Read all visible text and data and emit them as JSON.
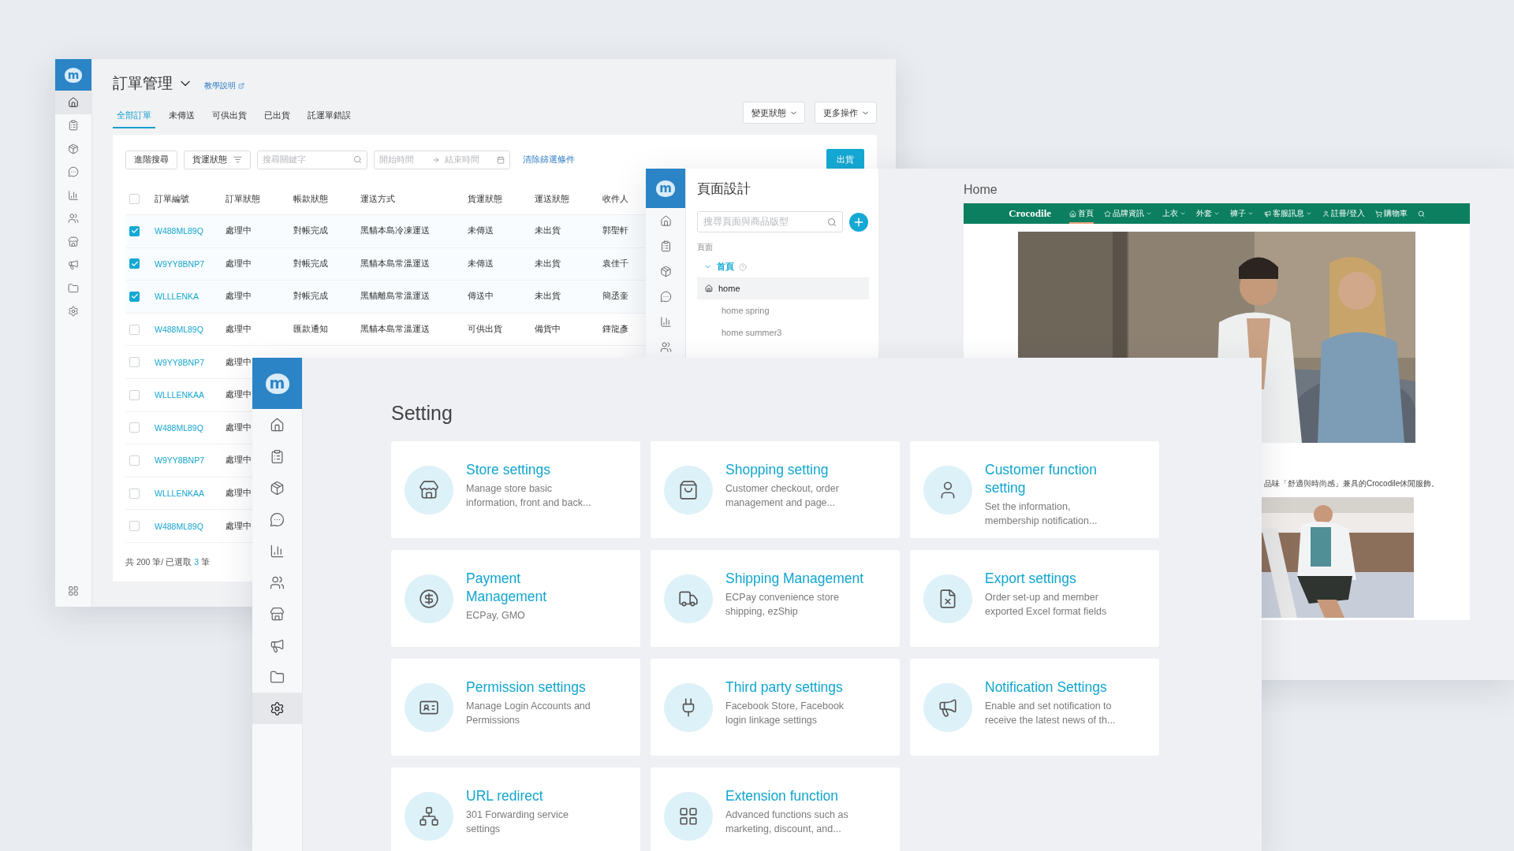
{
  "orders_window": {
    "sidebar": {
      "logo": "m",
      "items": [
        {
          "selected": true
        },
        {
          "selected": false
        },
        {
          "selected": false
        },
        {
          "selected": false
        },
        {
          "selected": false
        },
        {
          "selected": false
        },
        {
          "selected": false
        },
        {
          "selected": false
        },
        {
          "selected": false
        },
        {
          "selected": false
        }
      ]
    },
    "title": "訂單管理",
    "help_link": "教學說明",
    "tabs": [
      {
        "label": "全部訂單",
        "selected": true
      },
      {
        "label": "未傳送",
        "selected": false
      },
      {
        "label": "可供出貨",
        "selected": false
      },
      {
        "label": "已出貨",
        "selected": false
      },
      {
        "label": "託運單錯誤",
        "selected": false
      }
    ],
    "actions": [
      "變更狀態",
      "更多操作"
    ],
    "filters": {
      "advanced_search": "進階搜尋",
      "status_filter": "貨運狀態",
      "search": {
        "placeholder": "搜尋關鍵字"
      },
      "start_date": {
        "placeholder": "開始時間"
      },
      "end_date": {
        "placeholder": "結束時間"
      },
      "clear": "清除篩選條件"
    },
    "ship_button": "出貨",
    "table": {
      "select_all_checked": false,
      "columns": [
        "訂單編號",
        "訂單狀態",
        "帳款狀態",
        "運送方式",
        "貨運狀態",
        "運送狀態",
        "收件人"
      ],
      "rows": [
        {
          "checked": true,
          "cells": [
            "W488ML89Q",
            "處理中",
            "對帳完成",
            "黑貓本島冷凍運送",
            "未傳送",
            "未出貨",
            "郭聖軒"
          ]
        },
        {
          "checked": true,
          "cells": [
            "W9YY8BNP7",
            "處理中",
            "對帳完成",
            "黑貓本島常溫運送",
            "未傳送",
            "未出貨",
            "袁佳千"
          ]
        },
        {
          "checked": true,
          "cells": [
            "WLLLENKA",
            "處理中",
            "對帳完成",
            "黑貓離島常溫運送",
            "傳送中",
            "未出貨",
            "簡丞奎"
          ]
        },
        {
          "checked": false,
          "cells": [
            "W488ML89Q",
            "處理中",
            "匯款通知",
            "黑貓本島常溫運送",
            "可供出貨",
            "備貨中",
            "鍾龍彥"
          ]
        },
        {
          "checked": false,
          "cells": [
            "W9YY8BNP7",
            "處理中"
          ]
        },
        {
          "checked": false,
          "cells": [
            "WLLLENKAA",
            "處理中"
          ]
        },
        {
          "checked": false,
          "cells": [
            "W488ML89Q",
            "處理中"
          ]
        },
        {
          "checked": false,
          "cells": [
            "W9YY8BNP7",
            "處理中"
          ]
        },
        {
          "checked": false,
          "cells": [
            "WLLLENKAA",
            "處理中"
          ]
        },
        {
          "checked": false,
          "cells": [
            "W488ML89Q",
            "處理中"
          ]
        }
      ]
    },
    "footer": {
      "total": "共 200 筆/ 已選取",
      "selected_count": "3",
      "unit": "筆"
    }
  },
  "page_design_window": {
    "logo": "m",
    "title": "頁面設計",
    "search": {
      "placeholder": "搜尋頁面與商品版型"
    },
    "section_label": "頁面",
    "tree": [
      {
        "label": "首頁",
        "expanded": true,
        "children": [
          {
            "label": "home",
            "selected": true
          },
          {
            "label": "home spring",
            "selected": false
          },
          {
            "label": "home summer3",
            "selected": false
          }
        ]
      }
    ],
    "preview": {
      "title": "Home",
      "site_logo": "Crocodile",
      "nav": [
        {
          "label": "首頁",
          "selected": true,
          "dropdown": false
        },
        {
          "label": "品牌資訊",
          "selected": false,
          "dropdown": true
        },
        {
          "label": "上衣",
          "selected": false,
          "dropdown": true
        },
        {
          "label": "外套",
          "selected": false,
          "dropdown": true
        },
        {
          "label": "褲子",
          "selected": false,
          "dropdown": true
        },
        {
          "label": "客服訊息",
          "selected": false,
          "dropdown": true
        },
        {
          "label": "註冊/登入",
          "selected": false,
          "dropdown": false
        },
        {
          "label": "購物車",
          "selected": false,
          "dropdown": false
        }
      ],
      "caption": "品味「舒適與時尚感」兼具的Crocodile休閒服飾。"
    }
  },
  "setting_window": {
    "sidebar": {
      "logo": "m",
      "items": [
        {
          "selected": false
        },
        {
          "selected": false
        },
        {
          "selected": false
        },
        {
          "selected": false
        },
        {
          "selected": false
        },
        {
          "selected": false
        },
        {
          "selected": false
        },
        {
          "selected": false
        },
        {
          "selected": false
        },
        {
          "selected": true
        }
      ]
    },
    "title": "Setting",
    "cards": [
      {
        "title": "Store settings",
        "description": "Manage store basic information, front and back..."
      },
      {
        "title": "Shopping setting",
        "description": "Customer checkout, order management and page..."
      },
      {
        "title": "Customer function setting",
        "description": "Set the information, membership notification..."
      },
      {
        "title": "Payment Management",
        "description": "ECPay, GMO"
      },
      {
        "title": "Shipping Management",
        "description": "ECPay convenience store shipping, ezShip"
      },
      {
        "title": "Export settings",
        "description": "Order set-up and member exported Excel format fields"
      },
      {
        "title": "Permission settings",
        "description": "Manage Login Accounts and Permissions"
      },
      {
        "title": "Third party settings",
        "description": "Facebook Store, Facebook login linkage settings"
      },
      {
        "title": "Notification Settings",
        "description": "Enable and set notification to receive the latest news of th..."
      },
      {
        "title": "URL redirect",
        "description": "301 Forwarding service settings"
      },
      {
        "title": "Extension function",
        "description": "Advanced functions such as marketing, discount, and..."
      }
    ]
  }
}
